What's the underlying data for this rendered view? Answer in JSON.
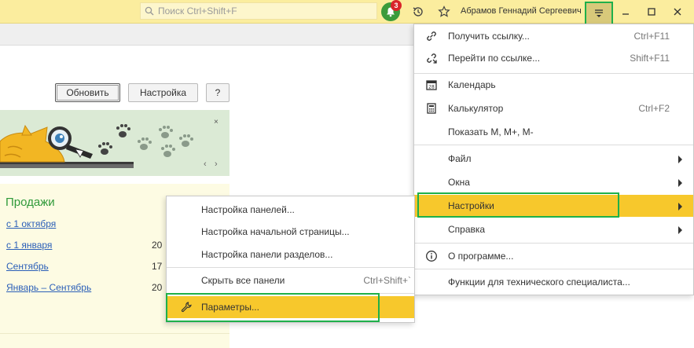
{
  "titlebar": {
    "search_placeholder": "Поиск Ctrl+Shift+F",
    "notifications_count": "3",
    "user_name": "Абрамов Геннадий Сергеевич"
  },
  "toolbar": {
    "refresh_label": "Обновить",
    "settings_label": "Настройка",
    "help_label": "?"
  },
  "banner": {
    "close_label": "×",
    "prev_label": "‹",
    "next_label": "›"
  },
  "sales": {
    "title": "Продажи",
    "rows": [
      {
        "label": "с 1 октября",
        "value": ""
      },
      {
        "label": "с 1 января",
        "value": "20"
      },
      {
        "label": "Сентябрь",
        "value": "17"
      },
      {
        "label": "Январь – Сентябрь",
        "value": "20"
      }
    ]
  },
  "main_menu": {
    "items": [
      {
        "label": "Получить ссылку...",
        "shortcut": "Ctrl+F11",
        "icon": "link-icon"
      },
      {
        "label": "Перейти по ссылке...",
        "shortcut": "Shift+F11",
        "icon": "goto-link-icon"
      },
      {
        "label": "Календарь",
        "shortcut": "",
        "icon": "calendar-icon"
      },
      {
        "label": "Калькулятор",
        "shortcut": "Ctrl+F2",
        "icon": "calculator-icon"
      },
      {
        "label": "Показать M, M+, M-",
        "shortcut": "",
        "icon": ""
      },
      {
        "label": "Файл",
        "shortcut": "",
        "icon": ""
      },
      {
        "label": "Окна",
        "shortcut": "",
        "icon": ""
      },
      {
        "label": "Настройки",
        "shortcut": "",
        "icon": ""
      },
      {
        "label": "Справка",
        "shortcut": "",
        "icon": ""
      },
      {
        "label": "О программе...",
        "shortcut": "",
        "icon": "info-icon"
      },
      {
        "label": "Функции для технического специалиста...",
        "shortcut": "",
        "icon": ""
      }
    ]
  },
  "submenu": {
    "items": [
      {
        "label": "Настройка панелей...",
        "shortcut": ""
      },
      {
        "label": "Настройка начальной страницы...",
        "shortcut": ""
      },
      {
        "label": "Настройка панели разделов...",
        "shortcut": ""
      },
      {
        "label": "Скрыть все панели",
        "shortcut": "Ctrl+Shift+`"
      },
      {
        "label": "Параметры...",
        "shortcut": ""
      }
    ]
  },
  "colors": {
    "titlebar": "#fbed9e",
    "highlight": "#f7c82c",
    "green_outline": "#1fb04a",
    "link": "#2b5fb8",
    "sales_title": "#2f9a3a"
  }
}
